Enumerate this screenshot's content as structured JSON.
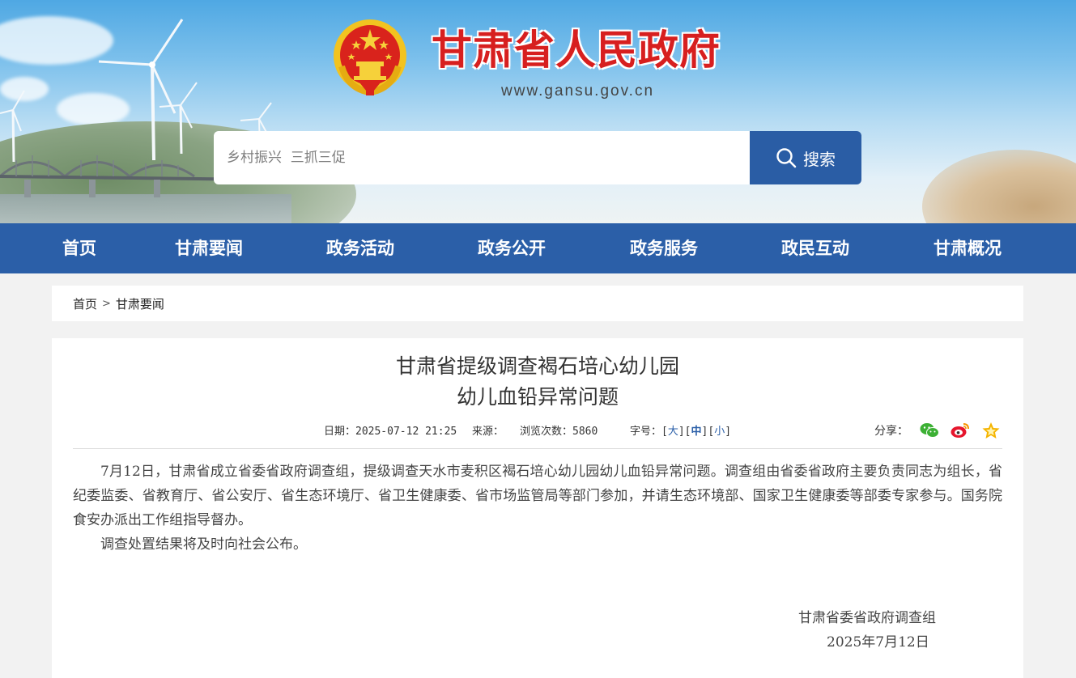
{
  "header": {
    "site_title": "甘肃省人民政府",
    "site_url": "www.gansu.gov.cn",
    "search": {
      "placeholder": "乡村振兴  三抓三促",
      "button_label": "搜索"
    }
  },
  "nav": {
    "items": [
      {
        "label": "首页"
      },
      {
        "label": "甘肃要闻"
      },
      {
        "label": "政务活动"
      },
      {
        "label": "政务公开"
      },
      {
        "label": "政务服务"
      },
      {
        "label": "政民互动"
      },
      {
        "label": "甘肃概况"
      }
    ]
  },
  "breadcrumb": {
    "home": "首页",
    "separator": ">",
    "current": "甘肃要闻"
  },
  "article": {
    "title_line1": "甘肃省提级调查褐石培心幼儿园",
    "title_line2": "幼儿血铅异常问题",
    "meta": {
      "date_label": "日期：2025-07-12 21:25",
      "source_label": "来源：",
      "views_label": "浏览次数：5860",
      "font_label": "字号：",
      "font_large": "大",
      "font_medium": "中",
      "font_small": "小"
    },
    "share_label": "分享：",
    "paragraphs": [
      "7月12日，甘肃省成立省委省政府调查组，提级调查天水市麦积区褐石培心幼儿园幼儿血铅异常问题。调查组由省委省政府主要负责同志为组长，省纪委监委、省教育厅、省公安厅、省生态环境厅、省卫生健康委、省市场监管局等部门参加，并请生态环境部、国家卫生健康委等部委专家参与。国务院食安办派出工作组指导督办。",
      "调查处置结果将及时向社会公布。"
    ],
    "signature_org": "甘肃省委省政府调查组",
    "signature_date": "2025年7月12日"
  },
  "colors": {
    "nav_bg": "#2b5fa8",
    "search_button": "#2a5da5",
    "title_red": "#d71f1f",
    "page_bg": "#f2f2f2"
  },
  "icons": [
    "search-icon",
    "wechat-icon",
    "weibo-icon",
    "favorite-star-icon",
    "national-emblem"
  ]
}
